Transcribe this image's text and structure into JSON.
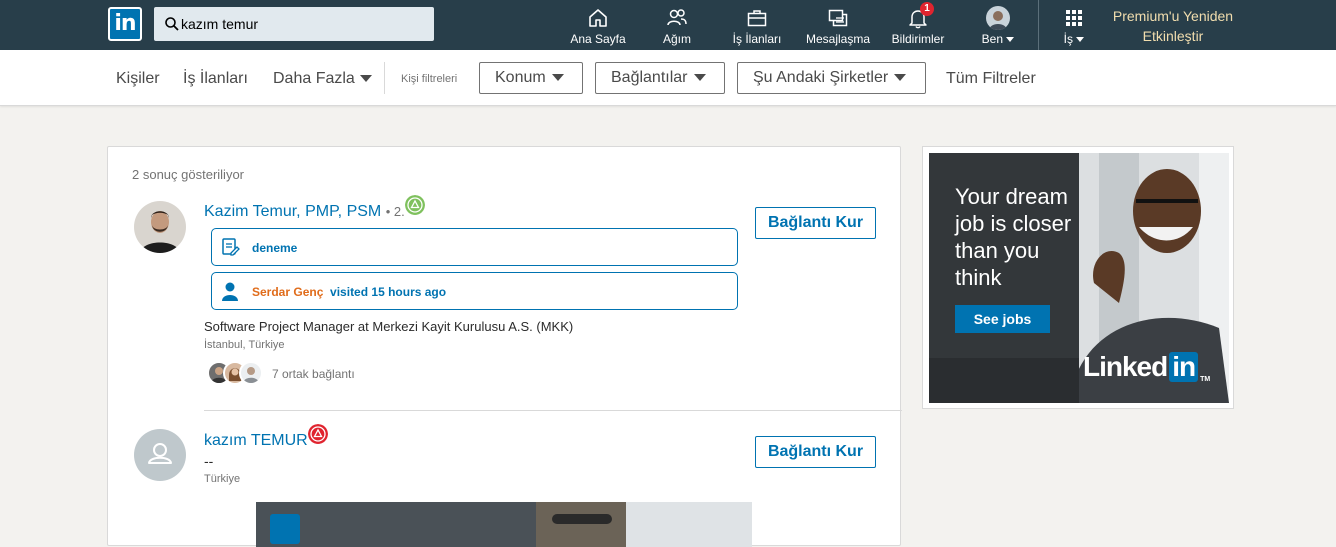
{
  "topbar": {
    "logo_text": "in",
    "search": {
      "value": "kazım temur",
      "placeholder": ""
    },
    "nav": [
      {
        "label": "Ana Sayfa",
        "icon": "home-icon"
      },
      {
        "label": "Ağım",
        "icon": "people-icon"
      },
      {
        "label": "İş İlanları",
        "icon": "briefcase-icon"
      },
      {
        "label": "Mesajlaşma",
        "icon": "messaging-icon"
      },
      {
        "label": "Bildirimler",
        "icon": "bell-icon",
        "badge": "1"
      },
      {
        "label": "Ben",
        "icon": "profile-avatar"
      },
      {
        "label": "İş",
        "icon": "grid-icon"
      }
    ],
    "premium_line1": "Premium'u Yeniden",
    "premium_line2": "Etkinleştir"
  },
  "filters": {
    "people": "Kişiler",
    "jobs": "İş İlanları",
    "more": "Daha Fazla",
    "people_filters": "Kişi filtreleri",
    "location": "Konum",
    "connections": "Bağlantılar",
    "current_companies": "Şu Andaki Şirketler",
    "all_filters": "Tüm Filtreler"
  },
  "results": {
    "count_text": "2 sonuç gösteriliyor",
    "items": [
      {
        "name": "Kazim Temur, PMP, PSM",
        "degree": "• 2.",
        "status_color": "#7fc15e",
        "insights": [
          {
            "icon": "note-icon",
            "text": "deneme"
          },
          {
            "icon": "person-icon",
            "who": "Serdar Genç",
            "text": "visited 15 hours ago"
          }
        ],
        "headline": "Software Project Manager at Merkezi Kayit Kurulusu A.S. (MKK)",
        "location": "İstanbul, Türkiye",
        "shared": "7 ortak bağlantı",
        "action": "Bağlantı Kur"
      },
      {
        "name": "kazım TEMUR",
        "status_color": "#e0242f",
        "headline": "--",
        "location": "Türkiye",
        "action": "Bağlantı Kur"
      }
    ]
  },
  "ad": {
    "headline": "Your dream job is closer than you think",
    "cta": "See jobs",
    "brand": "Linked",
    "brand_in": "in",
    "brand_tm": "TM"
  },
  "colors": {
    "nav_bg": "#283e4a",
    "brand": "#0073b1",
    "premium": "#f1ddae",
    "highlight_name": "#e06c1b"
  }
}
